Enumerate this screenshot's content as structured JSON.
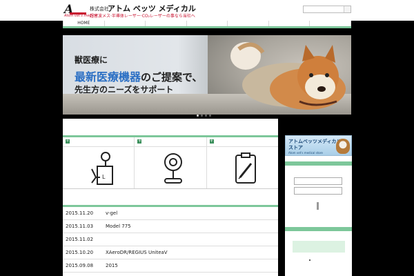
{
  "header": {
    "logo_letter": "A",
    "logo_subtitle": "Atom vet's medical",
    "company_prefix": "株式会社",
    "company_name": "アトム ベッツ メディカル",
    "tagline": "超音波メス·半導体レーザー·CO₂レーザーの事なら当社へ",
    "search": {
      "placeholder": ""
    }
  },
  "nav": {
    "items": [
      "HOME",
      "",
      "",
      "",
      "",
      "",
      ""
    ]
  },
  "hero": {
    "line1": "獣医療に",
    "line2_highlight": "最新医療機器",
    "line2_rest": "のご提案で、",
    "line3": "先生方のニーズをサポート",
    "slides": 4,
    "active_slide": 1
  },
  "categories": [
    {
      "icon": "ultrasound-device-icon"
    },
    {
      "icon": "stethoscope-icon"
    },
    {
      "icon": "clipboard-syringe-icon"
    }
  ],
  "news": [
    {
      "date": "2015.11.20",
      "title": "v-gel"
    },
    {
      "date": "2015.11.03",
      "title": "Model 775"
    },
    {
      "date": "2015.11.02",
      "title": ""
    },
    {
      "date": "2015.10.20",
      "title": "XAeroDR/REGIUS UniteaV"
    },
    {
      "date": "2015.09.08",
      "title": "2015"
    }
  ],
  "sidebar": {
    "store_line1": "アトムベッツメディカル",
    "store_line2": "ストア",
    "store_line3": "Atom vet's medical store"
  },
  "colors": {
    "accent": "#7dc79a",
    "brand_red": "#c8102e",
    "highlight_blue": "#2b6fc4"
  }
}
